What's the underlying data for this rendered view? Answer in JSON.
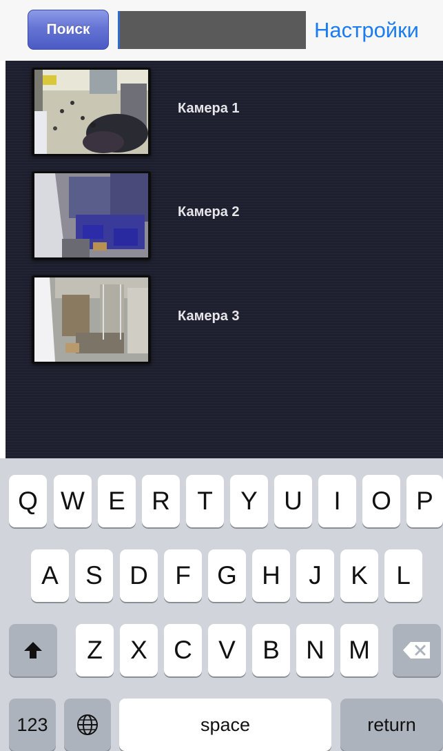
{
  "header": {
    "search_button_label": "Поиск",
    "search_input_value": "",
    "settings_label": "Настройки"
  },
  "cameras": [
    {
      "label": "Камера 1",
      "thumbnail_icon": "camera-thumbnail-crowd-hall"
    },
    {
      "label": "Камера 2",
      "thumbnail_icon": "camera-thumbnail-warehouse-aisle"
    },
    {
      "label": "Камера 3",
      "thumbnail_icon": "camera-thumbnail-storage-room"
    }
  ],
  "keyboard": {
    "row1": [
      "Q",
      "W",
      "E",
      "R",
      "T",
      "Y",
      "U",
      "I",
      "O",
      "P"
    ],
    "row2": [
      "A",
      "S",
      "D",
      "F",
      "G",
      "H",
      "J",
      "K",
      "L"
    ],
    "row3": [
      "Z",
      "X",
      "C",
      "V",
      "B",
      "N",
      "M"
    ],
    "shift_icon": "shift-arrow-icon",
    "delete_icon": "backspace-icon",
    "numbers_label": "123",
    "globe_icon": "globe-icon",
    "space_label": "space",
    "return_label": "return"
  },
  "colors": {
    "list_background": "#1d1f2e",
    "settings_link": "#1a7cf0",
    "search_button": "#6574d4",
    "keyboard_background": "#d1d5db"
  }
}
